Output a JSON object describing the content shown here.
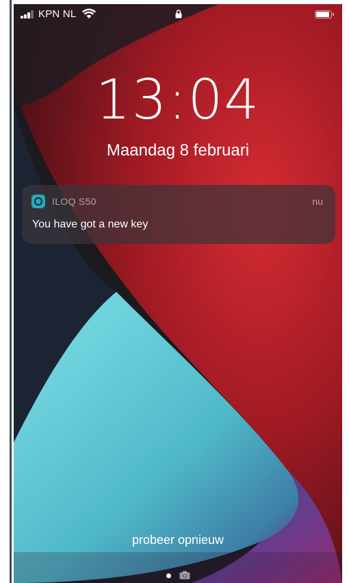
{
  "status_bar": {
    "carrier": "KPN NL",
    "signal_bars": 4,
    "signal_bars_active": 3,
    "wifi_icon": "wifi-icon",
    "lock_icon": "lock-icon",
    "battery_icon": "battery-icon",
    "battery_level": 0.9
  },
  "lock_screen": {
    "time": "13:04",
    "date": "Maandag 8 februari"
  },
  "notification": {
    "app_icon": "iloq-app-icon",
    "app_name": "ILOQ S50",
    "time": "nu",
    "message": "You have got a new key"
  },
  "bottom": {
    "retry_text": "probeer opnieuw",
    "page_indicator_icon": "page-dot-icon",
    "camera_icon": "camera-icon"
  },
  "colors": {
    "wallpaper_red": "#c5242d",
    "wallpaper_teal": "#5fc9d6",
    "wallpaper_dark": "#1b1a1f",
    "app_icon_teal": "#2aa7b8",
    "page_background": "#ffffff",
    "left_edge": "#3a4c59"
  }
}
